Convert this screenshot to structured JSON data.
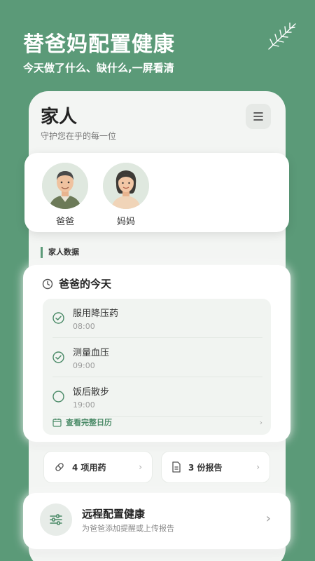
{
  "hero": {
    "title": "替爸妈配置健康",
    "subtitle": "今天做了什么、缺什么,一屏看清"
  },
  "header": {
    "title": "家人",
    "subtitle": "守护您在乎的每一位",
    "menu_icon": "hamburger-menu-icon"
  },
  "members": [
    {
      "name": "爸爸",
      "avatar": "elderly-man-avatar"
    },
    {
      "name": "妈妈",
      "avatar": "elderly-woman-avatar"
    }
  ],
  "section_label": "家人数据",
  "today": {
    "title": "爸爸的今天",
    "tasks": [
      {
        "title": "服用降压药",
        "time": "08:00",
        "done": true
      },
      {
        "title": "测量血压",
        "time": "09:00",
        "done": true
      },
      {
        "title": "饭后散步",
        "time": "19:00",
        "done": false
      }
    ],
    "calendar_link": "查看完整日历"
  },
  "summary": {
    "meds_label": "4 项用药",
    "reports_label": "3 份报告"
  },
  "remote": {
    "title": "远程配置健康",
    "subtitle": "为爸爸添加提醒或上传报告"
  },
  "colors": {
    "background": "#5b9a78",
    "accent": "#4a8a67",
    "card": "#ffffff"
  }
}
